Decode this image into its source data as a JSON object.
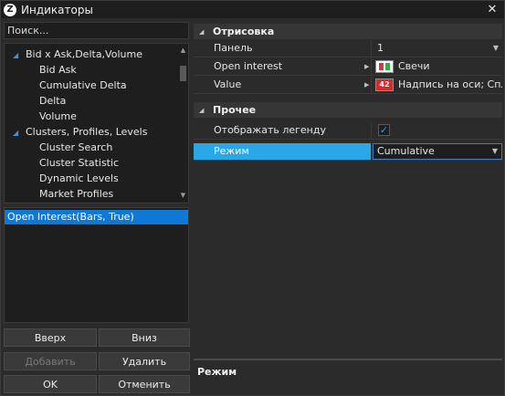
{
  "window": {
    "title": "Индикаторы",
    "close_glyph": "✕",
    "logo_glyph": "Z"
  },
  "search": {
    "placeholder": "Поиск..."
  },
  "tree": {
    "groups": [
      {
        "label": "Bid x Ask,Delta,Volume",
        "items": [
          "Bid Ask",
          "Cumulative Delta",
          "Delta",
          "Volume"
        ]
      },
      {
        "label": "Clusters, Profiles, Levels",
        "items": [
          "Cluster Search",
          "Cluster Statistic",
          "Dynamic Levels",
          "Market Profiles"
        ]
      }
    ]
  },
  "selected_indicators": [
    "Open Interest(Bars, True)"
  ],
  "buttons": {
    "up": "Вверх",
    "down": "Вниз",
    "add": "Добавить",
    "remove": "Удалить",
    "ok": "OK",
    "cancel": "Отменить"
  },
  "properties": {
    "cat_draw": "Отрисовка",
    "panel_label": "Панель",
    "panel_value": "1",
    "oi_label": "Open interest",
    "oi_value": "Свечи",
    "value_label": "Value",
    "value_badge": "42",
    "value_value": "Надпись на оси;  Сплошная",
    "cat_other": "Прочее",
    "legend_label": "Отображать легенду индикатора",
    "legend_checked": true,
    "mode_label": "Режим",
    "mode_value": "Cumulative"
  },
  "description": {
    "title": "Режим"
  },
  "colors": {
    "selection": "#0f78d6",
    "highlight": "#29a7e6",
    "accent": "#3a92e8"
  }
}
